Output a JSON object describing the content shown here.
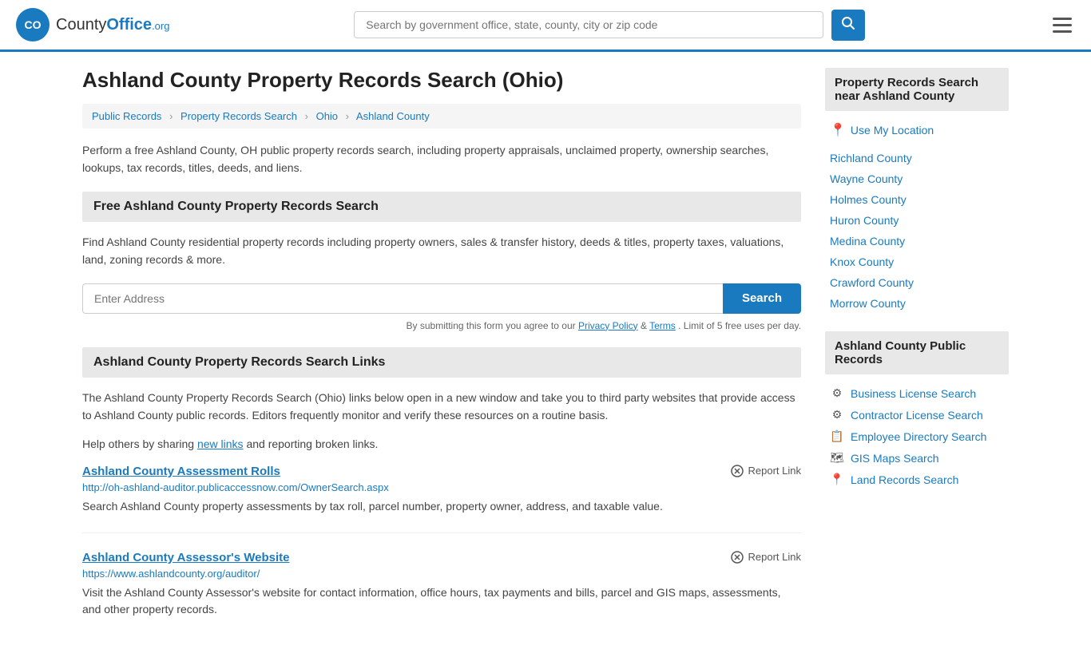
{
  "header": {
    "logo_text": "County",
    "logo_org": "Office",
    "logo_domain": ".org",
    "search_placeholder": "Search by government office, state, county, city or zip code",
    "search_btn_label": "🔍"
  },
  "breadcrumb": {
    "items": [
      {
        "label": "Public Records",
        "href": "#"
      },
      {
        "label": "Property Records Search",
        "href": "#"
      },
      {
        "label": "Ohio",
        "href": "#"
      },
      {
        "label": "Ashland County",
        "href": "#"
      }
    ]
  },
  "page": {
    "title": "Ashland County Property Records Search (Ohio)",
    "description": "Perform a free Ashland County, OH public property records search, including property appraisals, unclaimed property, ownership searches, lookups, tax records, titles, deeds, and liens."
  },
  "free_search": {
    "header": "Free Ashland County Property Records Search",
    "description": "Find Ashland County residential property records including property owners, sales & transfer history, deeds & titles, property taxes, valuations, land, zoning records & more.",
    "address_placeholder": "Enter Address",
    "search_btn": "Search",
    "form_note": "By submitting this form you agree to our",
    "privacy_policy": "Privacy Policy",
    "and": "&",
    "terms": "Terms",
    "limit": ". Limit of 5 free uses per day."
  },
  "links_section": {
    "header": "Ashland County Property Records Search Links",
    "description": "The Ashland County Property Records Search (Ohio) links below open in a new window and take you to third party websites that provide access to Ashland County public records. Editors frequently monitor and verify these resources on a routine basis.",
    "help_text": "Help others by sharing",
    "new_links_label": "new links",
    "and_reporting": "and reporting broken links.",
    "links": [
      {
        "title": "Ashland County Assessment Rolls",
        "url": "http://oh-ashland-auditor.publicaccessnow.com/OwnerSearch.aspx",
        "description": "Search Ashland County property assessments by tax roll, parcel number, property owner, address, and taxable value.",
        "report_label": "Report Link"
      },
      {
        "title": "Ashland County Assessor's Website",
        "url": "https://www.ashlandcounty.org/auditor/",
        "description": "Visit the Ashland County Assessor's website for contact information, office hours, tax payments and bills, parcel and GIS maps, assessments, and other property records.",
        "report_label": "Report Link"
      }
    ]
  },
  "sidebar": {
    "nearby_title": "Property Records Search near Ashland County",
    "use_my_location": "Use My Location",
    "counties": [
      "Richland County",
      "Wayne County",
      "Holmes County",
      "Huron County",
      "Medina County",
      "Knox County",
      "Crawford County",
      "Morrow County"
    ],
    "public_records_title": "Ashland County Public Records",
    "public_records": [
      {
        "icon": "⚙⚙",
        "label": "Business License Search"
      },
      {
        "icon": "⚙",
        "label": "Contractor License Search"
      },
      {
        "icon": "📋",
        "label": "Employee Directory Search"
      },
      {
        "icon": "🗺",
        "label": "GIS Maps Search"
      },
      {
        "icon": "📍",
        "label": "Land Records Search"
      }
    ]
  }
}
